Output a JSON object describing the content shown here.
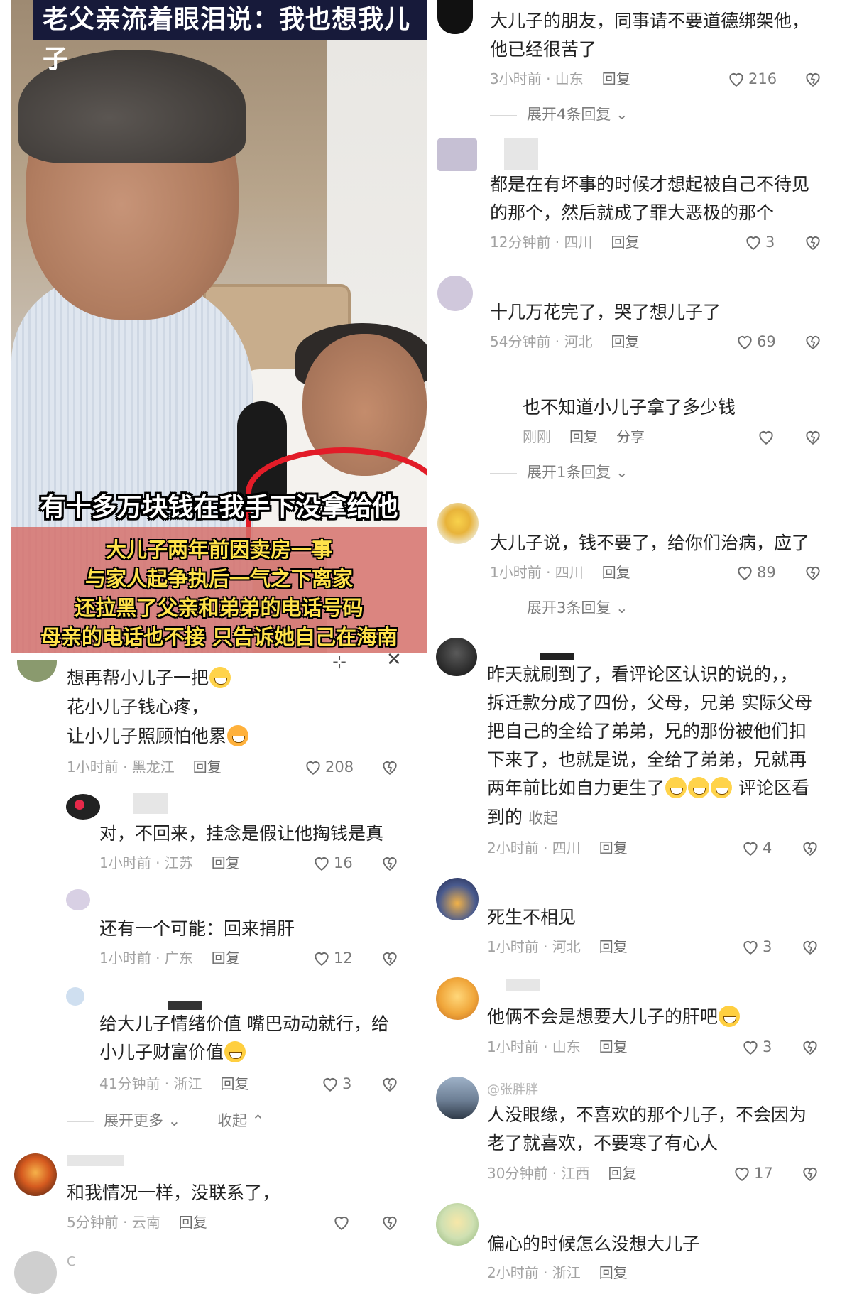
{
  "video": {
    "title": "老父亲流着眼泪说：我也想我儿子",
    "subtitle_main": "有十多万块钱在我手下没拿给他",
    "subtitle_lines": [
      "大儿子两年前因卖房一事",
      "与家人起争执后一气之下离家",
      "还拉黑了父亲和弟弟的电话号码",
      "母亲的电话也不接 只告诉她自己在海南"
    ]
  },
  "reply_label": "回复",
  "share_label": "分享",
  "fold_label": "收起",
  "left_comments": [
    {
      "lines": [
        "想再帮小儿子一把",
        "花小儿子钱心疼，",
        "让小儿子照顾怕他累"
      ],
      "time": "1小时前 · 黑龙江",
      "likes": "208"
    },
    {
      "lines": [
        "对，不回来，挂念是假让他掏钱是真"
      ],
      "time": "1小时前 · 江苏",
      "likes": "16"
    },
    {
      "lines": [
        "还有一个可能：回来捐肝"
      ],
      "time": "1小时前 · 广东",
      "likes": "12"
    },
    {
      "lines": [
        "给大儿子情绪价值 嘴巴动动就行，给",
        "小儿子财富价值"
      ],
      "time": "41分钟前 · 浙江",
      "likes": "3"
    },
    {
      "lines": [
        "和我情况一样，没联系了，"
      ],
      "time": "5分钟前 · 云南",
      "likes": ""
    }
  ],
  "left_expand": {
    "more": "展开更多",
    "fold": "收起"
  },
  "left_partial_name": "C",
  "right_comments": [
    {
      "lines": [
        "大儿子的朋友，同事请不要道德绑架他，",
        "他已经很苦了"
      ],
      "time": "3小时前 · 山东",
      "likes": "216",
      "expand": "展开4条回复"
    },
    {
      "lines": [
        "都是在有坏事的时候才想起被自己不待见",
        "的那个，然后就成了罪大恶极的那个"
      ],
      "time": "12分钟前 · 四川",
      "likes": "3"
    },
    {
      "lines": [
        "十几万花完了，哭了想儿子了"
      ],
      "time": "54分钟前 · 河北",
      "likes": "69"
    },
    {
      "lines": [
        "也不知道小儿子拿了多少钱"
      ],
      "time": "刚刚",
      "likes": "",
      "expand": "展开1条回复"
    },
    {
      "lines": [
        "大儿子说，钱不要了，给你们治病，应了"
      ],
      "time": "1小时前 · 四川",
      "likes": "89",
      "expand": "展开3条回复"
    },
    {
      "lines": [
        "昨天就刷到了，看评论区认识的说的，，",
        "拆迁款分成了四份，父母，兄弟  实际父母",
        "把自己的全给了弟弟，兄的那份被他们扣",
        "下来了，也就是说，全给了弟弟，兄就再",
        "两年前比如自力更生了",
        "到的"
      ],
      "tail": "评论区看",
      "time": "2小时前 · 四川",
      "likes": "4"
    },
    {
      "lines": [
        "死生不相见"
      ],
      "time": "1小时前 · 河北",
      "likes": "3"
    },
    {
      "lines": [
        "他俩不会是想要大儿子的肝吧"
      ],
      "time": "1小时前 · 山东",
      "likes": "3"
    },
    {
      "lines": [
        "人没眼缘，不喜欢的那个儿子，不会因为",
        "老了就喜欢，不要寒了有心人"
      ],
      "time": "30分钟前 · 江西",
      "likes": "17",
      "name": "@张胖胖"
    },
    {
      "lines": [
        "偏心的时候怎么没想大儿子"
      ],
      "time": "2小时前 · 浙江",
      "likes": ""
    }
  ]
}
